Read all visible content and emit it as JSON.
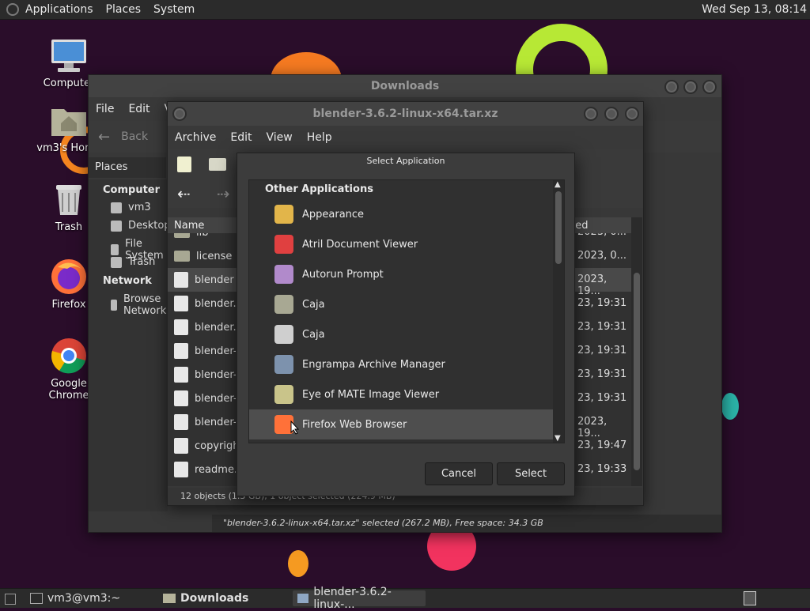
{
  "top_panel": {
    "menus": [
      "Applications",
      "Places",
      "System"
    ],
    "clock": "Wed Sep 13, 08:14"
  },
  "desktop": {
    "icons": [
      {
        "label": "Computer",
        "icon": "computer-icon"
      },
      {
        "label": "vm3's Home",
        "icon": "home-folder-icon"
      },
      {
        "label": "Trash",
        "icon": "trash-icon"
      },
      {
        "label": "Firefox",
        "icon": "firefox-icon"
      },
      {
        "label": "Google Chrome",
        "icon": "chrome-icon"
      }
    ]
  },
  "caja_window": {
    "title": "Downloads",
    "menu": [
      "File",
      "Edit",
      "V"
    ],
    "back_label": "Back",
    "places_label": "Places",
    "sidebar": {
      "computer_header": "Computer",
      "computer_items": [
        "vm3",
        "Desktop",
        "File System",
        "Trash"
      ],
      "network_header": "Network",
      "network_items": [
        "Browse Network"
      ]
    },
    "status": "\"blender-3.6.2-linux-x64.tar.xz\" selected (267.2 MB), Free space: 34.3 GB"
  },
  "archive_window": {
    "title": "blender-3.6.2-linux-x64.tar.xz",
    "menu": [
      "Archive",
      "Edit",
      "View",
      "Help"
    ],
    "column_name": "Name",
    "column_modified": "Modified",
    "files": [
      {
        "name": "lib",
        "date": "2023, 0..."
      },
      {
        "name": "license",
        "date": "2023, 0..."
      },
      {
        "name": "blender",
        "date": "2023, 19..."
      },
      {
        "name": "blender.desktop",
        "date": "23, 19:31"
      },
      {
        "name": "blender.svg",
        "date": "23, 19:31"
      },
      {
        "name": "blender-softwaregl",
        "date": "23, 19:31"
      },
      {
        "name": "blender-thumbnailer",
        "date": "23, 19:31"
      },
      {
        "name": "blender-symbolic.svg",
        "date": "23, 19:31"
      },
      {
        "name": "blender-launcher",
        "date": "2023, 19..."
      },
      {
        "name": "copyright.txt",
        "date": "23, 19:47"
      },
      {
        "name": "readme.html",
        "date": "23, 19:33"
      }
    ],
    "status": "12 objects (1.3 GB), 1 object selected (224.9 MB)"
  },
  "dialog": {
    "title": "Select Application",
    "list_header": "Other Applications",
    "apps": [
      {
        "label": "Appearance",
        "icon": "appearance-icon"
      },
      {
        "label": "Atril Document Viewer",
        "icon": "atril-icon"
      },
      {
        "label": "Autorun Prompt",
        "icon": "autorun-icon"
      },
      {
        "label": "Caja",
        "icon": "caja-folder-icon"
      },
      {
        "label": "Caja",
        "icon": "caja-cabinet-icon"
      },
      {
        "label": "Engrampa Archive Manager",
        "icon": "engrampa-icon"
      },
      {
        "label": "Eye of MATE Image Viewer",
        "icon": "eom-icon"
      },
      {
        "label": "Firefox Web Browser",
        "icon": "firefox-icon"
      }
    ],
    "selected_index": 7,
    "cancel_label": "Cancel",
    "select_label": "Select"
  },
  "taskbar": {
    "items": [
      "vm3@vm3:~",
      "Downloads",
      "blender-3.6.2-linux-..."
    ]
  }
}
